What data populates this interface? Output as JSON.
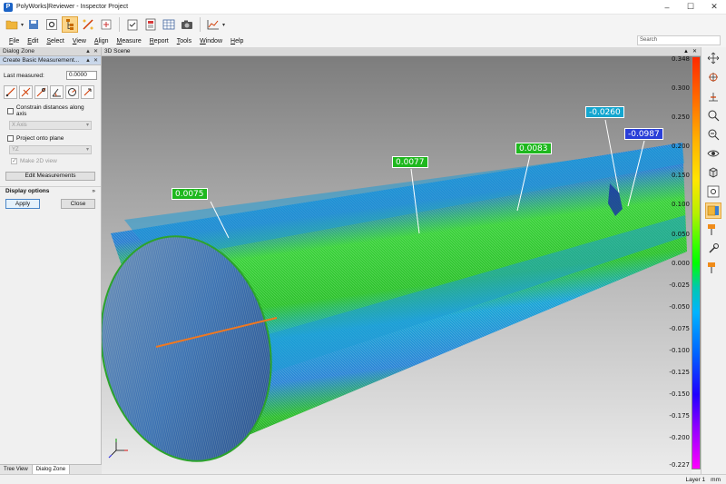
{
  "window": {
    "title": "PolyWorks|Reviewer - Inspector Project"
  },
  "menu": [
    "File",
    "Edit",
    "Select",
    "View",
    "Align",
    "Measure",
    "Report",
    "Tools",
    "Window",
    "Help"
  ],
  "search": {
    "placeholder": "Search"
  },
  "dialog_zone": {
    "title": "Dialog Zone",
    "subtitle": "Create Basic Measurement...",
    "last_measured_label": "Last measured:",
    "last_measured_value": "0.0000",
    "constrain_label": "Constrain distances along axis",
    "constrain_option": "X Axis",
    "project_label": "Project onto plane",
    "project_option": "YZ",
    "make2d_label": "Make 2D view",
    "edit_button": "Edit Measurements",
    "display_options": "Display options",
    "apply_button": "Apply",
    "close_button": "Close",
    "tabs": [
      "Tree View",
      "Dialog Zone"
    ]
  },
  "scene": {
    "title": "3D Scene",
    "callouts": [
      {
        "value": "0.0075",
        "color": "#1eb81e"
      },
      {
        "value": "0.0077",
        "color": "#1eb81e"
      },
      {
        "value": "0.0083",
        "color": "#1eb81e"
      },
      {
        "value": "-0.0260",
        "color": "#14a6cf"
      },
      {
        "value": "-0.0987",
        "color": "#2a3fd8"
      }
    ]
  },
  "color_scale": {
    "labels": [
      "0.348",
      "0.300",
      "0.250",
      "0.200",
      "0.150",
      "0.100",
      "0.050",
      "0.000",
      "-0.025",
      "-0.050",
      "-0.075",
      "-0.100",
      "-0.125",
      "-0.150",
      "-0.175",
      "-0.200",
      "-0.227"
    ]
  },
  "status": {
    "layer": "Layer 1",
    "units": "mm"
  }
}
